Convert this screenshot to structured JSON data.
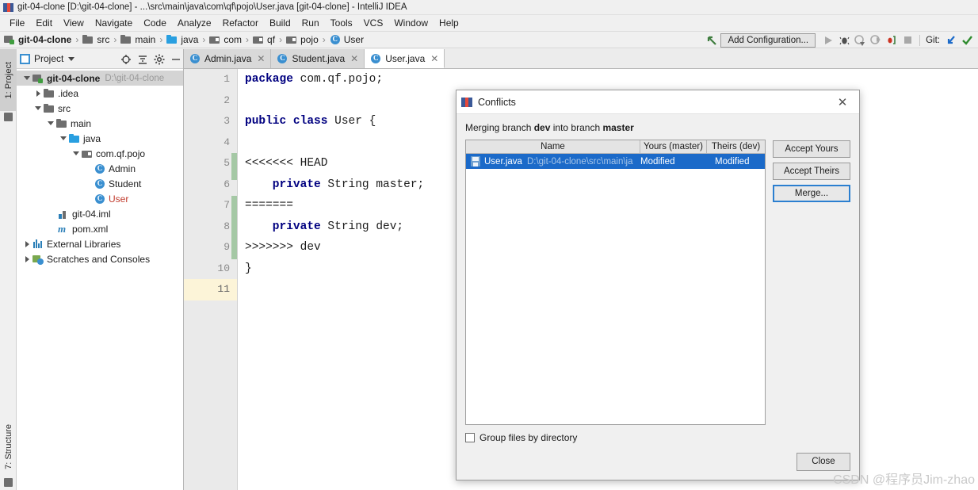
{
  "window": {
    "title": "git-04-clone [D:\\git-04-clone] - ...\\src\\main\\java\\com\\qf\\pojo\\User.java [git-04-clone] - IntelliJ IDEA",
    "app_icon": "intellij-idea-icon"
  },
  "menubar": {
    "items": [
      "File",
      "Edit",
      "View",
      "Navigate",
      "Code",
      "Analyze",
      "Refactor",
      "Build",
      "Run",
      "Tools",
      "VCS",
      "Window",
      "Help"
    ]
  },
  "breadcrumb": {
    "items": [
      {
        "label": "git-04-clone",
        "icon": "project-module-icon",
        "bold": true
      },
      {
        "label": "src",
        "icon": "folder-icon",
        "bold": false
      },
      {
        "label": "main",
        "icon": "folder-icon",
        "bold": false
      },
      {
        "label": "java",
        "icon": "source-folder-icon",
        "bold": false
      },
      {
        "label": "com",
        "icon": "package-icon",
        "bold": false
      },
      {
        "label": "qf",
        "icon": "package-icon",
        "bold": false
      },
      {
        "label": "pojo",
        "icon": "package-icon",
        "bold": false
      },
      {
        "label": "User",
        "icon": "java-class-icon",
        "bold": false
      }
    ],
    "separator": "›"
  },
  "toolbar": {
    "back_arrow_icon": "back-arrow-icon",
    "add_configuration_label": "Add Configuration...",
    "run_icon": "run-icon",
    "debug_icon": "debug-icon",
    "coverage_icon": "run-with-coverage-icon",
    "profile_icon": "profile-icon",
    "attach_icon": "attach-debugger-icon",
    "stop_icon": "stop-icon",
    "git_label": "Git:",
    "update_project_icon": "update-project-icon",
    "commit_icon": "commit-checkmark-icon"
  },
  "rails": {
    "left_top": {
      "label": "1: Project",
      "icon": "project-tool-icon"
    },
    "left_bottom": {
      "label": "7: Structure",
      "icon": "structure-tool-icon"
    }
  },
  "project_panel": {
    "header": {
      "title": "Project",
      "view_icon": "project-view-icon",
      "dropdown_icon": "chevron-down-icon",
      "locate_icon": "scroll-from-source-icon",
      "collapse_icon": "collapse-all-icon",
      "settings_icon": "gear-icon",
      "hide_icon": "hide-icon"
    },
    "tree": [
      {
        "label": "git-04-clone",
        "path": "D:\\git-04-clone",
        "icon": "project-module-icon",
        "indent": 0,
        "twisty": "open",
        "bold": true,
        "selected": true,
        "color": "default"
      },
      {
        "label": ".idea",
        "path": "",
        "icon": "folder-icon",
        "indent": 1,
        "twisty": "closed",
        "bold": false,
        "selected": false,
        "color": "default"
      },
      {
        "label": "src",
        "path": "",
        "icon": "folder-icon",
        "indent": 1,
        "twisty": "open",
        "bold": false,
        "selected": false,
        "color": "default"
      },
      {
        "label": "main",
        "path": "",
        "icon": "folder-icon",
        "indent": 2,
        "twisty": "open",
        "bold": false,
        "selected": false,
        "color": "default"
      },
      {
        "label": "java",
        "path": "",
        "icon": "source-folder-icon",
        "indent": 3,
        "twisty": "open",
        "bold": false,
        "selected": false,
        "color": "default"
      },
      {
        "label": "com.qf.pojo",
        "path": "",
        "icon": "package-icon",
        "indent": 4,
        "twisty": "open",
        "bold": false,
        "selected": false,
        "color": "default"
      },
      {
        "label": "Admin",
        "path": "",
        "icon": "java-class-icon",
        "indent": 5,
        "twisty": "none",
        "bold": false,
        "selected": false,
        "color": "default"
      },
      {
        "label": "Student",
        "path": "",
        "icon": "java-class-icon",
        "indent": 5,
        "twisty": "none",
        "bold": false,
        "selected": false,
        "color": "default"
      },
      {
        "label": "User",
        "path": "",
        "icon": "java-class-icon",
        "indent": 5,
        "twisty": "none",
        "bold": false,
        "selected": false,
        "color": "red"
      },
      {
        "label": "git-04.iml",
        "path": "",
        "icon": "iml-file-icon",
        "indent": 2,
        "twisty": "none",
        "bold": false,
        "selected": false,
        "color": "default"
      },
      {
        "label": "pom.xml",
        "path": "",
        "icon": "maven-pom-icon",
        "indent": 2,
        "twisty": "none",
        "bold": false,
        "selected": false,
        "color": "default"
      },
      {
        "label": "External Libraries",
        "path": "",
        "icon": "external-libraries-icon",
        "indent": 0,
        "twisty": "closed",
        "bold": false,
        "selected": false,
        "color": "default"
      },
      {
        "label": "Scratches and Consoles",
        "path": "",
        "icon": "scratches-icon",
        "indent": 0,
        "twisty": "closed",
        "bold": false,
        "selected": false,
        "color": "default"
      }
    ]
  },
  "editor": {
    "tabs": [
      {
        "label": "Admin.java",
        "icon": "java-class-icon",
        "active": false,
        "close_icon": "close-icon"
      },
      {
        "label": "Student.java",
        "icon": "java-class-icon",
        "active": false,
        "close_icon": "close-icon"
      },
      {
        "label": "User.java",
        "icon": "java-class-icon",
        "active": true,
        "close_icon": "close-icon"
      }
    ],
    "line_numbers": [
      "1",
      "2",
      "3",
      "4",
      "5",
      "6",
      "7",
      "8",
      "9",
      "10",
      "11"
    ],
    "highlighted_line": 11,
    "lines": [
      {
        "n": 1,
        "text": "package com.qf.pojo;",
        "kw": "package"
      },
      {
        "n": 2,
        "text": "",
        "kw": ""
      },
      {
        "n": 3,
        "text": "public class User {",
        "kw": "public class"
      },
      {
        "n": 4,
        "text": "",
        "kw": ""
      },
      {
        "n": 5,
        "text": "<<<<<<< HEAD",
        "kw": ""
      },
      {
        "n": 6,
        "text": "    private String master;",
        "kw": "private"
      },
      {
        "n": 7,
        "text": "=======",
        "kw": ""
      },
      {
        "n": 8,
        "text": "    private String dev;",
        "kw": "private"
      },
      {
        "n": 9,
        "text": ">>>>>>> dev",
        "kw": ""
      },
      {
        "n": 10,
        "text": "}",
        "kw": ""
      },
      {
        "n": 11,
        "text": "",
        "kw": ""
      }
    ],
    "code_text": {
      "l1_kw": "package",
      "l1_rest": " com.qf.pojo;",
      "l3_kw": "public class",
      "l3_rest": " User {",
      "l5": "<<<<<<< HEAD",
      "l6_kw": "    private",
      "l6_rest": " String master;",
      "l7": "=======",
      "l8_kw": "    private",
      "l8_rest": " String dev;",
      "l9": ">>>>>>> dev",
      "l10": "}"
    }
  },
  "dialog": {
    "title": "Conflicts",
    "title_icon": "intellij-idea-icon",
    "close_icon": "close-icon",
    "message_prefix": "Merging branch ",
    "message_branch_from": "dev",
    "message_middle": " into branch ",
    "message_branch_to": "master",
    "table": {
      "headers": [
        "Name",
        "Yours (master)",
        "Theirs (dev)"
      ],
      "rows": [
        {
          "icon": "merge-file-icon",
          "name": "User.java",
          "path": "D:\\git-04-clone\\src\\main\\ja",
          "yours": "Modified",
          "theirs": "Modified",
          "selected": true
        }
      ]
    },
    "buttons": [
      {
        "label": "Accept Yours",
        "focused": false
      },
      {
        "label": "Accept Theirs",
        "focused": false
      },
      {
        "label": "Merge...",
        "focused": true
      }
    ],
    "checkbox": {
      "label": "Group files by directory",
      "checked": false
    },
    "close_button": "Close"
  },
  "watermark": "CSDN @程序员Jim-zhao",
  "colors": {
    "accent_blue": "#1b6ac9",
    "focus_blue": "#2b7fd0",
    "conflict_marker_green": "#a5c8a5",
    "highlight_yellow": "#fcf4d8",
    "error_red": "#c0392b",
    "keyword_navy": "#000080"
  }
}
